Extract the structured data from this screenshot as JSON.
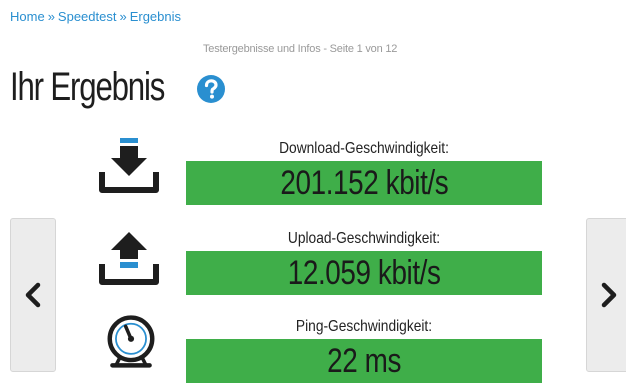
{
  "breadcrumb": {
    "items": [
      "Home",
      "Speedtest",
      "Ergebnis"
    ],
    "separator": "»"
  },
  "subtitle": "Testergebnisse und Infos - Seite 1 von 12",
  "page_title": "Ihr Ergebnis",
  "colors": {
    "accent": "#2a8fd0",
    "bar_green": "#3fae49",
    "icon_dark": "#1e1e1e"
  },
  "results": [
    {
      "icon": "download-icon",
      "label": "Download-Geschwindigkeit:",
      "value": "201.152 kbit/s"
    },
    {
      "icon": "upload-icon",
      "label": "Upload-Geschwindigkeit:",
      "value": "12.059 kbit/s"
    },
    {
      "icon": "ping-gauge-icon",
      "label": "Ping-Geschwindigkeit:",
      "value": "22 ms"
    }
  ],
  "nav": {
    "prev_icon": "chevron-left-icon",
    "next_icon": "chevron-right-icon"
  }
}
